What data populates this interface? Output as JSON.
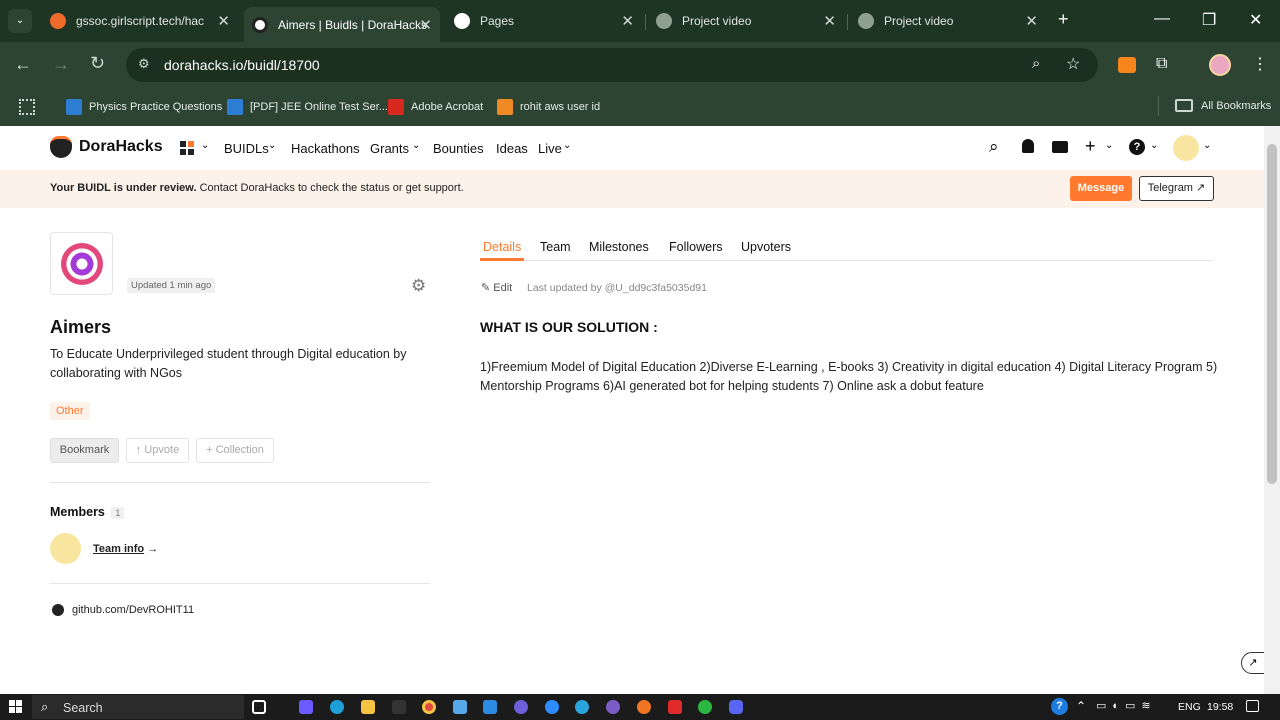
{
  "browser": {
    "tabs": [
      {
        "title": "gssoc.girlscript.tech/hack-w",
        "color": "#f06a2b"
      },
      {
        "title": "Aimers | Buidls | DoraHacks",
        "color": "#ffffff"
      },
      {
        "title": "Pages",
        "color": "#ffffff"
      },
      {
        "title": "Project video",
        "color": "#8fa08f"
      },
      {
        "title": "Project video",
        "color": "#8fa08f"
      }
    ],
    "url": "dorahacks.io/buidl/18700",
    "bookmarks": [
      "Physics Practice Questions",
      "[PDF] JEE Online Test Ser...",
      "Adobe Acrobat",
      "rohit aws user id"
    ],
    "all_bookmarks": "All Bookmarks"
  },
  "site": {
    "brand": "DoraHacks",
    "nav": [
      "BUIDLs",
      "Hackathons",
      "Grants",
      "Bounties",
      "Ideas",
      "Live"
    ],
    "banner": {
      "bold": "Your BUIDL is under review.",
      "text": "Contact DoraHacks to check the status or get support.",
      "message": "Message",
      "telegram": "Telegram ↗"
    },
    "project": {
      "updated": "Updated 1 min ago",
      "name": "Aimers",
      "tagline": "To Educate Underprivileged student through Digital education by collaborating with NGos",
      "tag": "Other",
      "bookmark": "Bookmark",
      "upvote": "↑ Upvote",
      "collection": "+ Collection",
      "members_label": "Members",
      "members_count": "1",
      "team_info": "Team info",
      "github": "github.com/DevROHIT11"
    },
    "tabs": [
      "Details",
      "Team",
      "Milestones",
      "Followers",
      "Upvoters"
    ],
    "edit": "Edit",
    "last_updated": "Last updated by @U_dd9c3fa5035d91",
    "heading": "WHAT IS OUR SOLUTION :",
    "body": "1)Freemium Model of Digital Education 2)Diverse E-Learning , E-books 3) Creativity in digital education 4) Digital Literacy Program 5) Mentorship Programs 6)AI generated bot for helping students 7) Online ask a dobut feature"
  },
  "taskbar": {
    "search": "Search",
    "lang": "ENG",
    "time": "19:58"
  }
}
